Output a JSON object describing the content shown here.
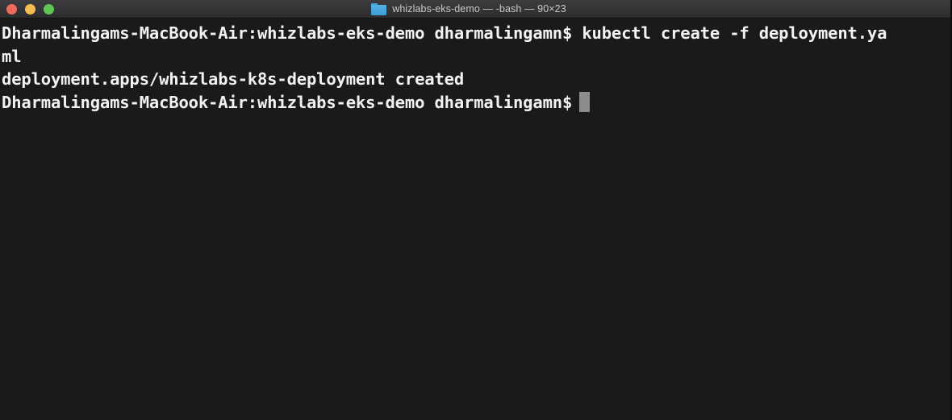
{
  "window": {
    "title": "whizlabs-eks-demo — -bash — 90×23",
    "folder_icon": "folder-icon",
    "traffic_lights": {
      "close_label": "close",
      "minimize_label": "minimize",
      "zoom_label": "zoom",
      "close_color": "#ee6a5f",
      "minimize_color": "#f5bd4f",
      "zoom_color": "#61c454"
    },
    "columns": 90,
    "rows": 23,
    "shell": "-bash"
  },
  "theme": {
    "titlebar_top": "#3c3c3e",
    "titlebar_bottom": "#2b2b2d",
    "terminal_background": "#1a1a1a",
    "terminal_foreground": "#f2f2f2",
    "title_text_color": "#c9c9c9",
    "cursor_color": "#8c8c8c",
    "folder_icon_color": "#3d9cd4"
  },
  "terminal": {
    "lines": [
      {
        "text": "Dharmalingams-MacBook-Air:whizlabs-eks-demo dharmalingamn$ kubectl create -f deployment.ya"
      },
      {
        "text": "ml"
      },
      {
        "text": "deployment.apps/whizlabs-k8s-deployment created"
      },
      {
        "text": "Dharmalingams-MacBook-Air:whizlabs-eks-demo dharmalingamn$ "
      }
    ],
    "prompt": "Dharmalingams-MacBook-Air:whizlabs-eks-demo dharmalingamn$",
    "command": "kubectl create -f deployment.yaml",
    "output": "deployment.apps/whizlabs-k8s-deployment created",
    "cursor": "block-cursor"
  }
}
